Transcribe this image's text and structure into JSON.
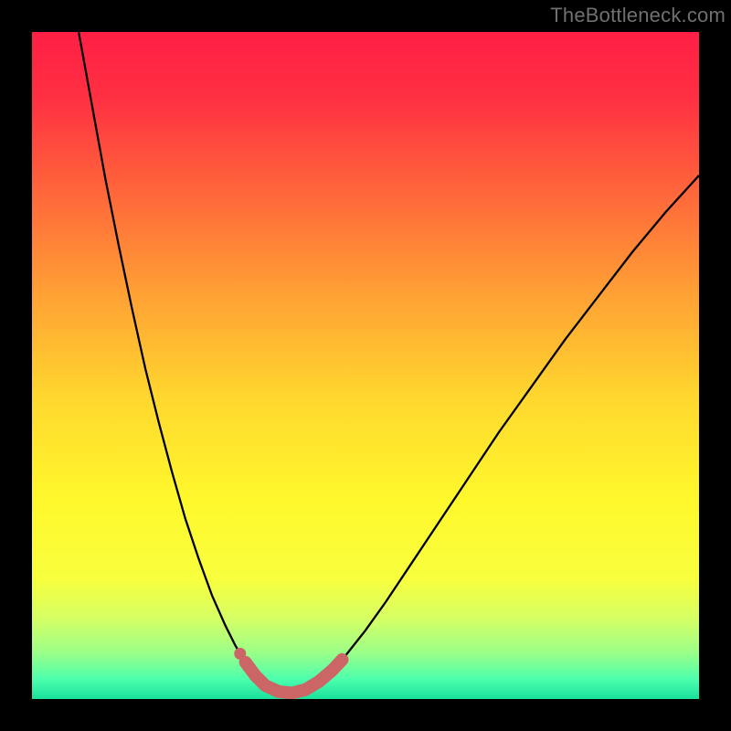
{
  "watermark": {
    "text": "TheBottleneck.com"
  },
  "chart_data": {
    "type": "line",
    "title": "",
    "xlabel": "",
    "ylabel": "",
    "xlim": [
      0,
      100
    ],
    "ylim": [
      0,
      100
    ],
    "grid": false,
    "legend": false,
    "background": {
      "type": "vertical_gradient",
      "stops": [
        {
          "offset": 0.0,
          "color": "#ff1f44"
        },
        {
          "offset": 0.1,
          "color": "#ff3042"
        },
        {
          "offset": 0.25,
          "color": "#ff6a3a"
        },
        {
          "offset": 0.4,
          "color": "#ffa334"
        },
        {
          "offset": 0.55,
          "color": "#ffd82e"
        },
        {
          "offset": 0.7,
          "color": "#fff82c"
        },
        {
          "offset": 0.82,
          "color": "#f8ff3e"
        },
        {
          "offset": 0.88,
          "color": "#d5ff65"
        },
        {
          "offset": 0.93,
          "color": "#9cff88"
        },
        {
          "offset": 0.97,
          "color": "#4dffad"
        },
        {
          "offset": 1.0,
          "color": "#19e19e"
        }
      ]
    },
    "series": [
      {
        "name": "bottleneck-curve",
        "color": "#000000",
        "width": 2.3,
        "points": [
          {
            "x": 7.0,
            "y": 100.0
          },
          {
            "x": 9.0,
            "y": 89.0
          },
          {
            "x": 11.0,
            "y": 78.0
          },
          {
            "x": 13.0,
            "y": 68.0
          },
          {
            "x": 15.0,
            "y": 58.5
          },
          {
            "x": 17.0,
            "y": 49.5
          },
          {
            "x": 19.0,
            "y": 41.5
          },
          {
            "x": 21.0,
            "y": 34.0
          },
          {
            "x": 23.0,
            "y": 27.0
          },
          {
            "x": 25.0,
            "y": 21.0
          },
          {
            "x": 27.0,
            "y": 15.5
          },
          {
            "x": 29.0,
            "y": 11.0
          },
          {
            "x": 30.5,
            "y": 8.0
          },
          {
            "x": 32.0,
            "y": 5.5
          },
          {
            "x": 33.5,
            "y": 3.5
          },
          {
            "x": 35.0,
            "y": 2.0
          },
          {
            "x": 37.0,
            "y": 1.0
          },
          {
            "x": 39.0,
            "y": 0.8
          },
          {
            "x": 41.0,
            "y": 1.3
          },
          {
            "x": 43.0,
            "y": 2.5
          },
          {
            "x": 45.0,
            "y": 4.3
          },
          {
            "x": 47.0,
            "y": 6.5
          },
          {
            "x": 50.0,
            "y": 10.3
          },
          {
            "x": 53.0,
            "y": 14.5
          },
          {
            "x": 56.0,
            "y": 19.0
          },
          {
            "x": 60.0,
            "y": 25.0
          },
          {
            "x": 65.0,
            "y": 32.5
          },
          {
            "x": 70.0,
            "y": 40.0
          },
          {
            "x": 75.0,
            "y": 47.0
          },
          {
            "x": 80.0,
            "y": 54.0
          },
          {
            "x": 85.0,
            "y": 60.5
          },
          {
            "x": 90.0,
            "y": 67.0
          },
          {
            "x": 95.0,
            "y": 73.0
          },
          {
            "x": 100.0,
            "y": 78.5
          }
        ]
      },
      {
        "name": "highlight-segment",
        "color": "#cc6666",
        "width": 14,
        "linecap": "round",
        "dot": {
          "x": 31.2,
          "y": 6.8,
          "r": 6.5
        },
        "points": [
          {
            "x": 32.0,
            "y": 5.5
          },
          {
            "x": 33.5,
            "y": 3.5
          },
          {
            "x": 35.0,
            "y": 2.0
          },
          {
            "x": 37.0,
            "y": 1.1
          },
          {
            "x": 39.0,
            "y": 0.9
          },
          {
            "x": 41.0,
            "y": 1.4
          },
          {
            "x": 43.0,
            "y": 2.6
          },
          {
            "x": 45.0,
            "y": 4.3
          },
          {
            "x": 46.5,
            "y": 5.9
          }
        ]
      }
    ]
  }
}
